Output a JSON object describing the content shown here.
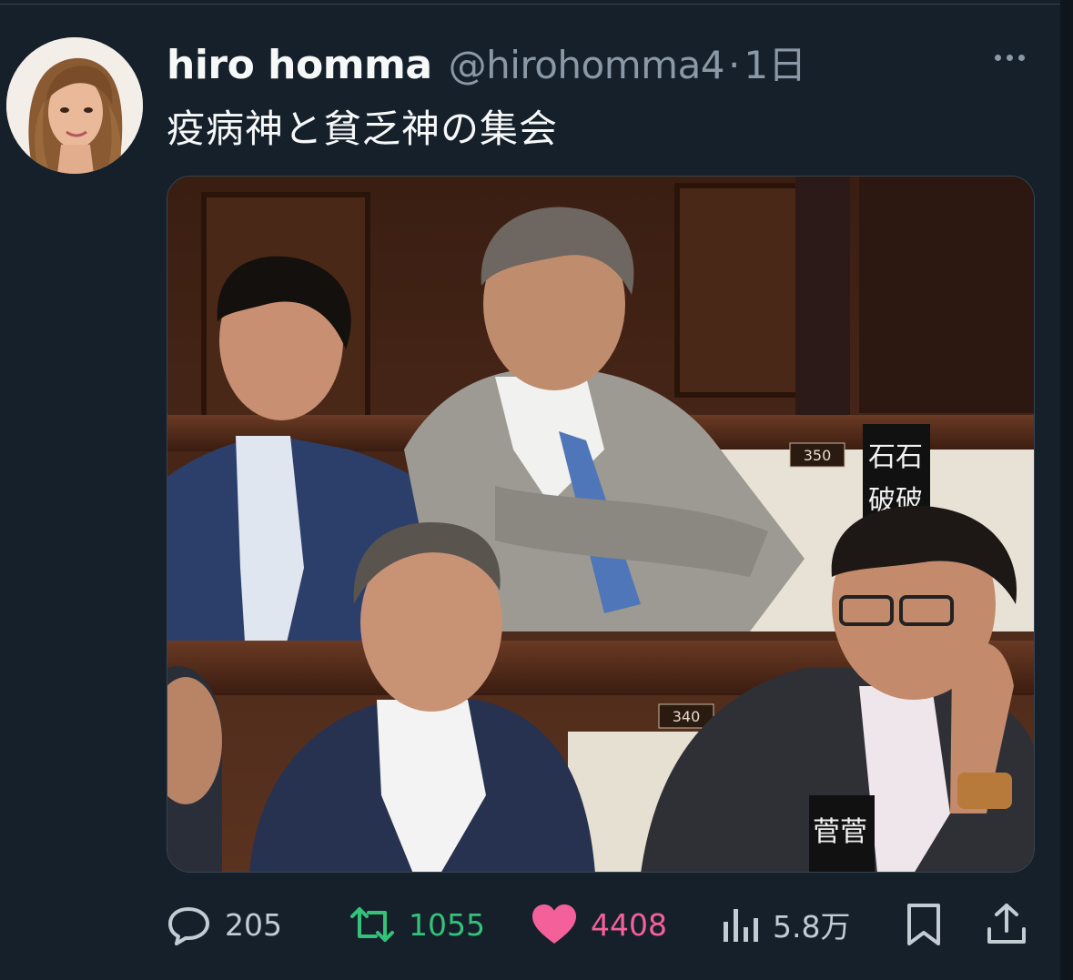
{
  "tweet": {
    "display_name": "hiro homma",
    "handle": "@hirohomma4",
    "separator": "·",
    "time": "1日",
    "text": "疫病神と貧乏神の集会"
  },
  "media": {
    "placards": {
      "top": "石石\n破破",
      "bottom": "菅菅"
    },
    "seat_numbers": {
      "upper": "350",
      "lower": "340"
    }
  },
  "actions": {
    "replies": "205",
    "retweets": "1055",
    "likes": "4408",
    "views": "5.8万"
  },
  "colors": {
    "background": "#15202b",
    "text_primary": "#f7f9f9",
    "text_secondary": "#8b98a5",
    "retweet": "#34c279",
    "like": "#f4619a"
  },
  "icons": [
    "reply-icon",
    "retweet-icon",
    "heart-icon",
    "views-icon",
    "bookmark-icon",
    "share-icon",
    "more-icon"
  ]
}
